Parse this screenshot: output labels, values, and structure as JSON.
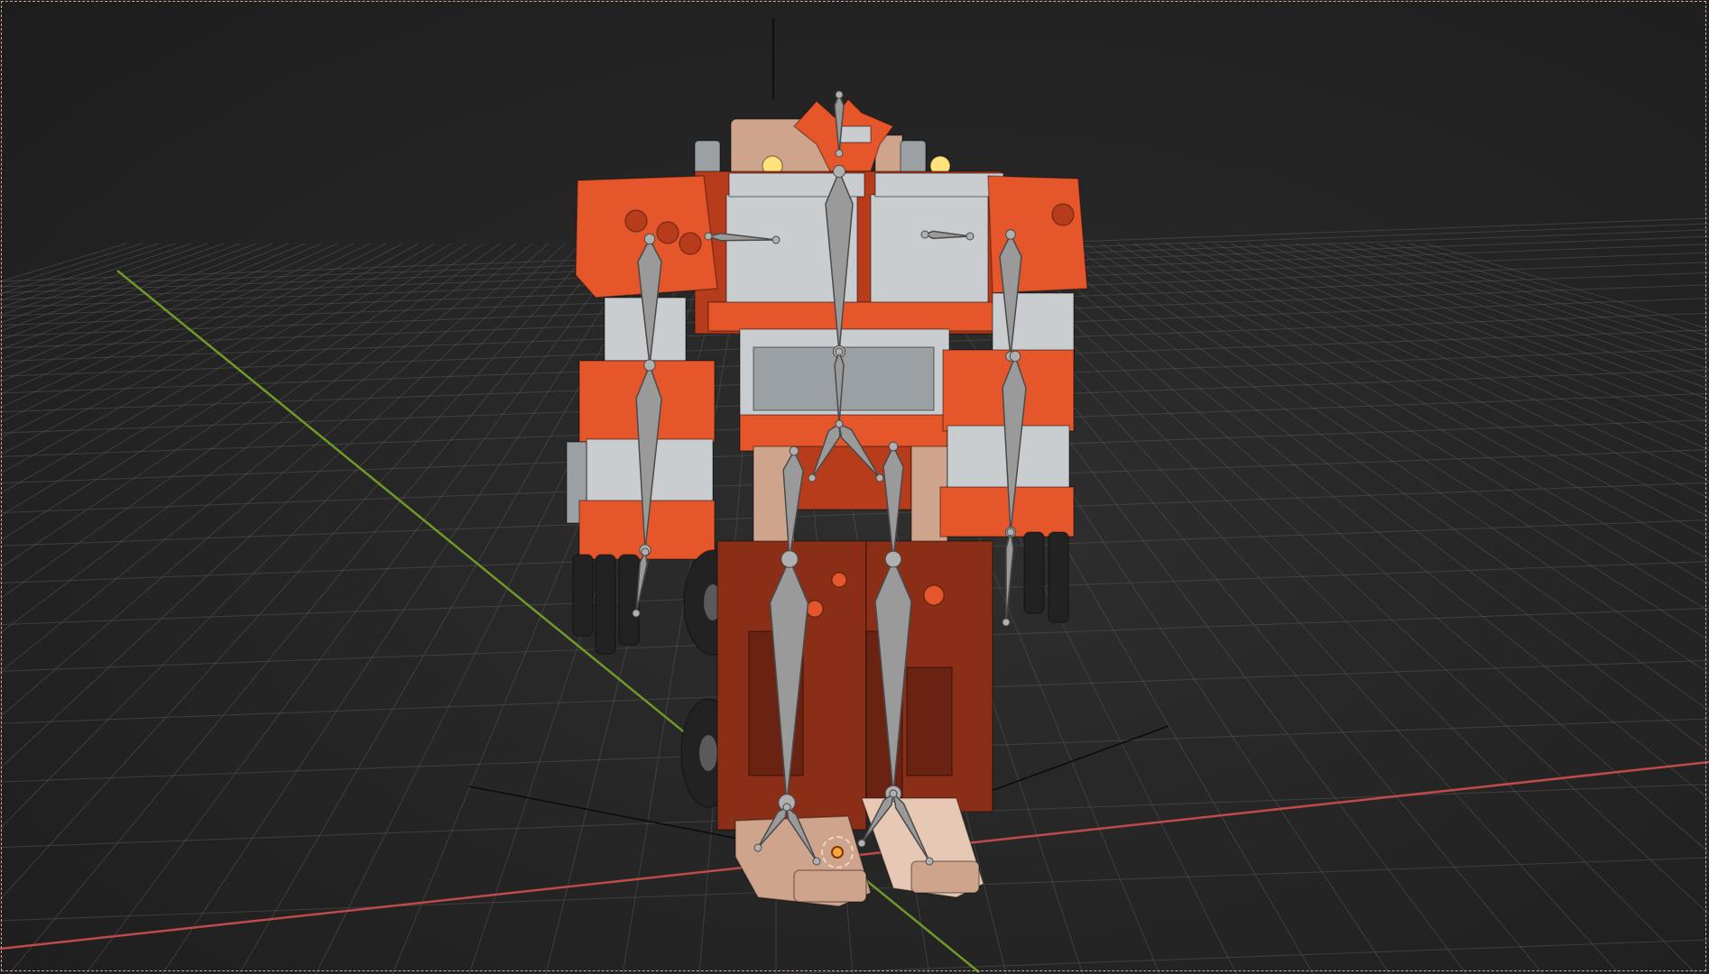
{
  "viewport": {
    "background": "#262626",
    "grid_color": "#555555",
    "x_axis_color": "#c04a4a",
    "y_axis_color": "#6e9a28",
    "frame_color": "#c9a89a"
  },
  "robot": {
    "colors": {
      "orange": "#e5562b",
      "orange_dark": "#b63c1c",
      "red_brown": "#8a2e17",
      "red_brown_dark": "#6a2212",
      "silver": "#c9cdd0",
      "silver_dark": "#9aa0a4",
      "tan": "#cfa48c",
      "tan_light": "#e6c8b4",
      "tire": "#222222",
      "light": "#ffe27a"
    }
  },
  "armature": {
    "bone_color": "#9a9a9a",
    "bone_edge": "#4a4a4a",
    "joint_color": "#b0b0b0"
  },
  "icons": [
    "3d-cursor-icon"
  ]
}
